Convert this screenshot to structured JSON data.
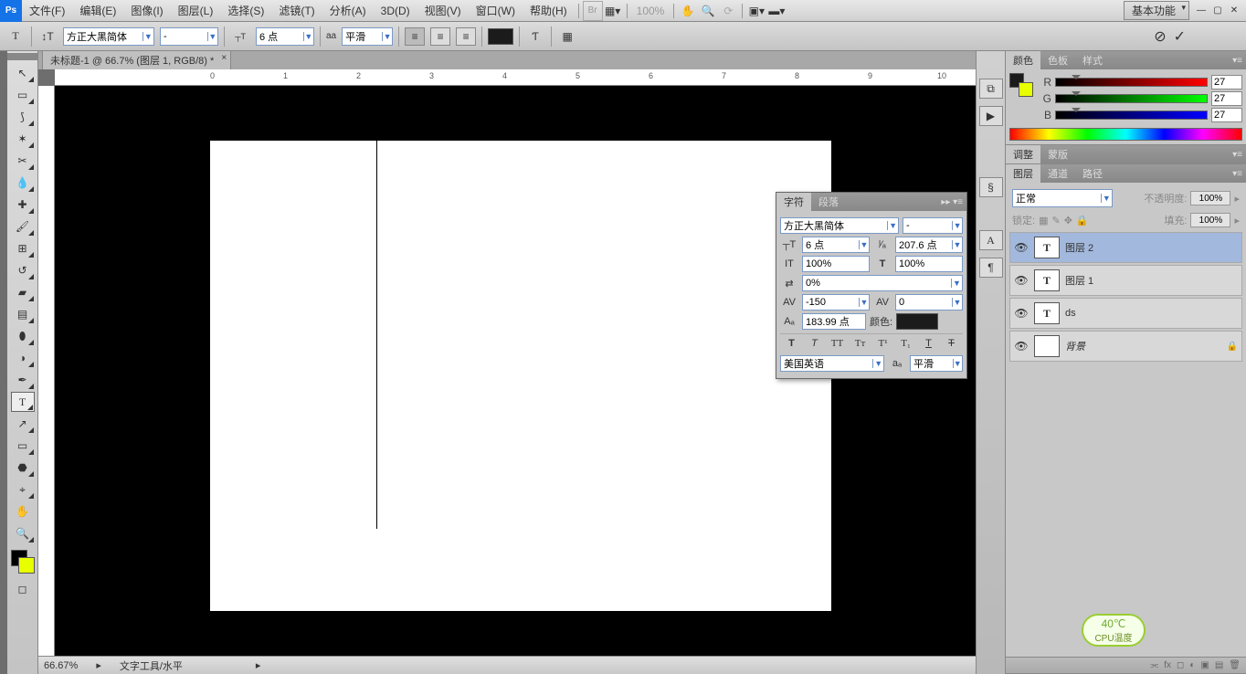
{
  "menubar": {
    "items": [
      "文件(F)",
      "编辑(E)",
      "图像(I)",
      "图层(L)",
      "选择(S)",
      "滤镜(T)",
      "分析(A)",
      "3D(D)",
      "视图(V)",
      "窗口(W)",
      "帮助(H)"
    ],
    "zoom_indicator": "100%",
    "workspace": "基本功能"
  },
  "options": {
    "font_family": "方正大黑简体",
    "font_style": "-",
    "font_size": "6 点",
    "aa_label": "aa",
    "aa_method": "平滑",
    "text_color": "#1b1b1b"
  },
  "document": {
    "tab_title": "未标题-1 @ 66.7% (图层 1, RGB/8) *",
    "zoom_status": "66.67%",
    "tool_status": "文字工具/水平"
  },
  "char_panel": {
    "tab1": "字符",
    "tab2": "段落",
    "font_family": "方正大黑简体",
    "font_style": "-",
    "size": "6 点",
    "leading": "207.6 点",
    "vscale": "100%",
    "hscale": "100%",
    "tracking": "0%",
    "kerning": "-150",
    "metrics": "0",
    "baseline": "183.99 点",
    "color_label": "颜色:",
    "language": "美国英语",
    "aa": "平滑"
  },
  "color_panel": {
    "tabs": [
      "颜色",
      "色板",
      "样式"
    ],
    "r": "27",
    "g": "27",
    "b": "27",
    "fg": "#1b1b1b",
    "bg": "#e8ff00"
  },
  "adjust_panel": {
    "tabs": [
      "调整",
      "蒙版"
    ]
  },
  "layers_panel": {
    "tabs": [
      "图层",
      "通道",
      "路径"
    ],
    "blend_mode": "正常",
    "opacity_label": "不透明度:",
    "opacity": "100%",
    "lock_label": "锁定:",
    "fill_label": "填充:",
    "fill": "100%",
    "layers": [
      {
        "name": "图层 2",
        "type": "T",
        "selected": true
      },
      {
        "name": "图层 1",
        "type": "T"
      },
      {
        "name": "ds",
        "type": "T"
      },
      {
        "name": "背景",
        "type": "bg",
        "locked": true,
        "italic": true
      }
    ]
  },
  "cpu": {
    "temp": "40℃",
    "label": "CPU温度"
  },
  "ruler_marks": [
    "0",
    "1",
    "2",
    "3",
    "4",
    "5",
    "6",
    "7",
    "8",
    "9",
    "10"
  ],
  "toolbox": {
    "fg": "#000000",
    "bg": "#e8ff00"
  }
}
